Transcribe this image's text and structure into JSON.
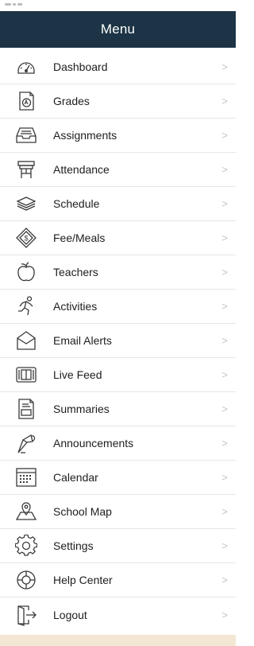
{
  "header": {
    "title": "Menu"
  },
  "colors": {
    "header_bg": "#1c3445",
    "header_text": "#ffffff",
    "icon_stroke": "#3a3a3a",
    "chevron": "#c4c4c4",
    "footer_band": "#f3e7d4"
  },
  "menu": {
    "items": [
      {
        "label": "Dashboard",
        "icon": "dashboard-icon"
      },
      {
        "label": "Grades",
        "icon": "grades-icon"
      },
      {
        "label": "Assignments",
        "icon": "assignments-icon"
      },
      {
        "label": "Attendance",
        "icon": "attendance-icon"
      },
      {
        "label": "Schedule",
        "icon": "schedule-icon"
      },
      {
        "label": "Fee/Meals",
        "icon": "fee-meals-icon"
      },
      {
        "label": "Teachers",
        "icon": "teachers-icon"
      },
      {
        "label": "Activities",
        "icon": "activities-icon"
      },
      {
        "label": "Email Alerts",
        "icon": "email-alerts-icon"
      },
      {
        "label": "Live Feed",
        "icon": "live-feed-icon"
      },
      {
        "label": "Summaries",
        "icon": "summaries-icon"
      },
      {
        "label": "Announcements",
        "icon": "announcements-icon"
      },
      {
        "label": "Calendar",
        "icon": "calendar-icon"
      },
      {
        "label": "School Map",
        "icon": "school-map-icon"
      },
      {
        "label": "Settings",
        "icon": "settings-icon"
      },
      {
        "label": "Help Center",
        "icon": "help-center-icon"
      },
      {
        "label": "Logout",
        "icon": "logout-icon"
      }
    ],
    "chevron": ">"
  }
}
